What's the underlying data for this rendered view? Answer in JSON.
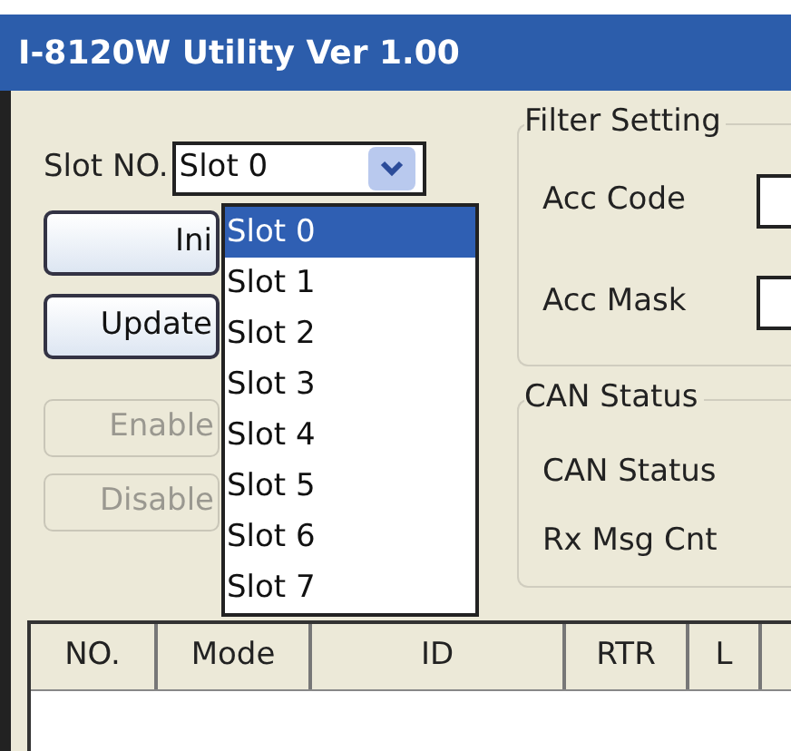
{
  "window": {
    "title": "I-8120W Utility Ver 1.00"
  },
  "slot": {
    "label": "Slot NO.",
    "value": "Slot 0",
    "expanded": true,
    "options": [
      {
        "label": "Slot 0",
        "selected": true
      },
      {
        "label": "Slot 1",
        "selected": false
      },
      {
        "label": "Slot 2",
        "selected": false
      },
      {
        "label": "Slot 3",
        "selected": false
      },
      {
        "label": "Slot 4",
        "selected": false
      },
      {
        "label": "Slot 5",
        "selected": false
      },
      {
        "label": "Slot 6",
        "selected": false
      },
      {
        "label": "Slot 7",
        "selected": false
      }
    ]
  },
  "buttons": [
    {
      "label": "Ini",
      "disabled": false
    },
    {
      "label": "Update",
      "disabled": false
    },
    {
      "label": "Enable",
      "disabled": true
    },
    {
      "label": "Disable",
      "disabled": true
    }
  ],
  "filter_setting": {
    "title": "Filter Setting",
    "fields": [
      {
        "label": "Acc Code"
      },
      {
        "label": "Acc Mask"
      }
    ]
  },
  "can_status": {
    "title": "CAN Status",
    "fields": [
      {
        "label": "CAN Status"
      },
      {
        "label": "Rx Msg Cnt"
      }
    ]
  },
  "table": {
    "columns": [
      "NO.",
      "Mode",
      "ID",
      "RTR",
      "L"
    ]
  }
}
